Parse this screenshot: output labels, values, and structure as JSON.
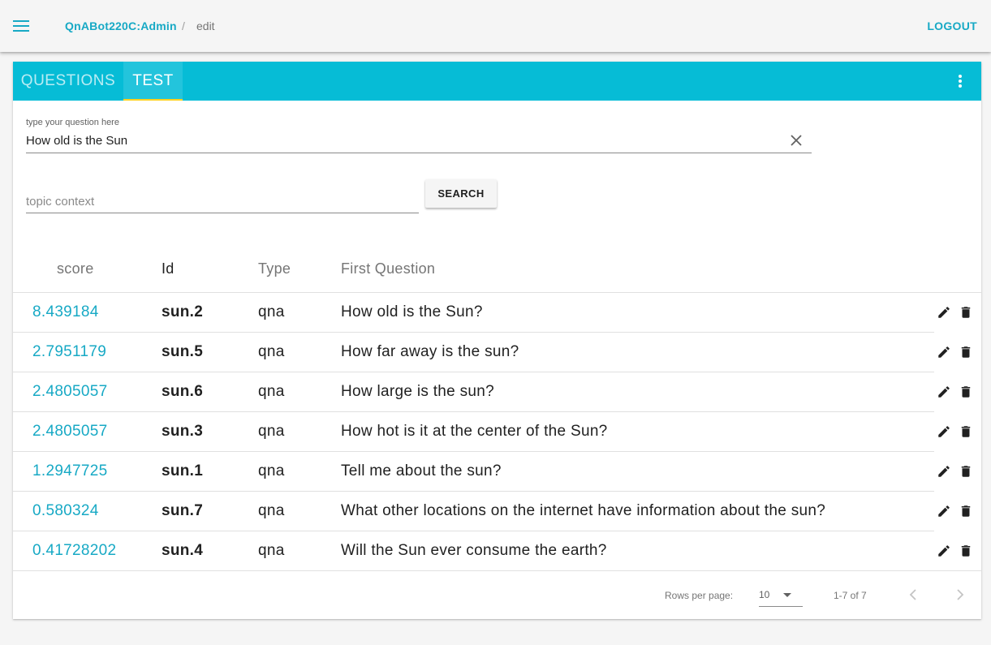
{
  "colors": {
    "accent": "#17a9c5",
    "tabbar": "#06bcd6",
    "tab_indicator": "#ffd21f"
  },
  "header": {
    "menu_icon": "menu-icon",
    "breadcrumb": {
      "home": "QnABot220C:Admin",
      "separator": "/",
      "current": "edit"
    },
    "logout_label": "LOGOUT"
  },
  "tabs": {
    "items": [
      {
        "label": "QUESTIONS",
        "active": false
      },
      {
        "label": "TEST",
        "active": true
      }
    ],
    "more_icon": "more-vertical-icon"
  },
  "test_form": {
    "question_label": "type your question here",
    "question_value": "How old is the Sun",
    "clear_icon": "close-icon",
    "topic_placeholder": "topic context",
    "topic_value": "",
    "search_label": "SEARCH"
  },
  "table": {
    "columns": [
      "score",
      "Id",
      "Type",
      "First Question"
    ],
    "rows": [
      {
        "score": "8.439184",
        "id": "sun.2",
        "type": "qna",
        "question": "How old is the Sun?"
      },
      {
        "score": "2.7951179",
        "id": "sun.5",
        "type": "qna",
        "question": "How far away is the sun?"
      },
      {
        "score": "2.4805057",
        "id": "sun.6",
        "type": "qna",
        "question": "How large is the sun?"
      },
      {
        "score": "2.4805057",
        "id": "sun.3",
        "type": "qna",
        "question": "How hot is it at the center of the Sun?"
      },
      {
        "score": "1.2947725",
        "id": "sun.1",
        "type": "qna",
        "question": "Tell me about the sun?"
      },
      {
        "score": "0.580324",
        "id": "sun.7",
        "type": "qna",
        "question": "What other locations on the internet have information about the sun?"
      },
      {
        "score": "0.41728202",
        "id": "sun.4",
        "type": "qna",
        "question": "Will the Sun ever consume the earth?"
      }
    ],
    "row_actions": [
      "pencil-icon",
      "trash-icon"
    ]
  },
  "pagination": {
    "rows_per_page_label": "Rows per page:",
    "rows_per_page_value": "10",
    "range_text": "1-7 of 7",
    "prev_icon": "chevron-left-icon",
    "next_icon": "chevron-right-icon"
  }
}
